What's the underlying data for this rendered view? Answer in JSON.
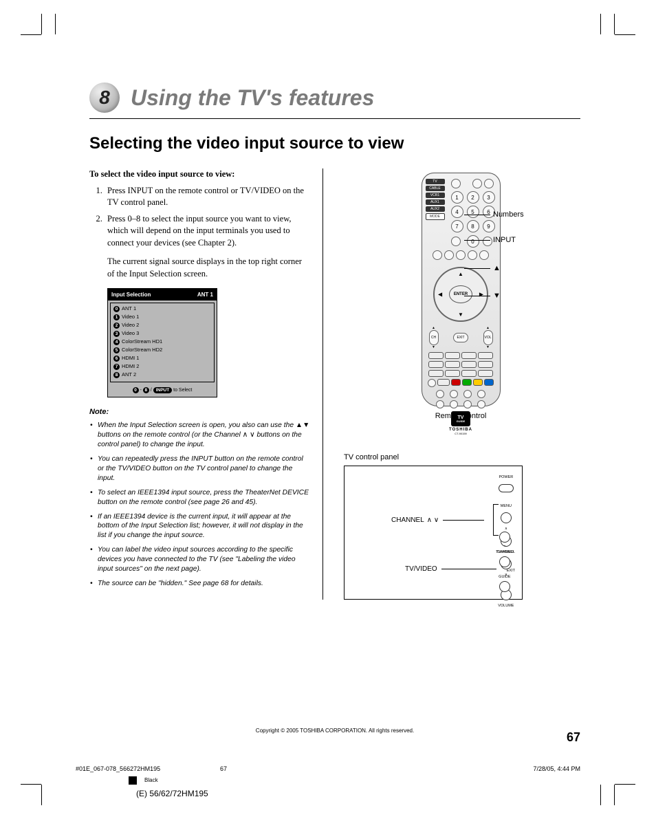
{
  "chapter": {
    "number": "8",
    "title": "Using the TV's features"
  },
  "section_title": "Selecting the video input source to view",
  "instr_head": "To select the video input source to view:",
  "steps": {
    "s1": "Press INPUT on the remote control or TV/VIDEO on the TV control panel.",
    "s2": "Press 0–8 to select the input source you want to view, which will depend on the input terminals you used to connect your devices (see Chapter 2)."
  },
  "followup": "The current signal source displays in the top right corner of the Input Selection screen.",
  "input_selection": {
    "title": "Input Selection",
    "current": "ANT 1",
    "items": [
      {
        "n": "0",
        "label": "ANT 1"
      },
      {
        "n": "1",
        "label": "Video 1"
      },
      {
        "n": "2",
        "label": "Video 2"
      },
      {
        "n": "3",
        "label": "Video 3"
      },
      {
        "n": "4",
        "label": "ColorStream HD1"
      },
      {
        "n": "5",
        "label": "ColorStream HD2"
      },
      {
        "n": "6",
        "label": "HDMI 1"
      },
      {
        "n": "7",
        "label": "HDMI 2"
      },
      {
        "n": "8",
        "label": "ANT 2"
      }
    ],
    "footer_btn": "INPUT",
    "footer_text": "to Select"
  },
  "note_head": "Note:",
  "notes": {
    "n1a": "When the Input Selection screen is open, you also can use the ",
    "n1b": " buttons on the remote control (or the Channel ",
    "n1c": " buttons on the control panel) to change the input.",
    "n2": "You can repeatedly press the INPUT button on the remote control or the TV/VIDEO button on the TV control panel to change the input.",
    "n3": "To select an IEEE1394 input source, press the TheaterNet DEVICE button on the remote control (see page 26 and 45).",
    "n4": "If an IEEE1394 device is the current input, it will appear at the bottom of the Input Selection list; however, it will not display in the list if you change the input source.",
    "n5": "You can label the video input sources according to the specific devices you have connected to the TV (see \"Labeling the video input sources\" on the next page).",
    "n6": "The source can be \"hidden.\" See page 68 for details."
  },
  "remote": {
    "caption": "Remote control",
    "callouts": {
      "numbers": "Numbers",
      "input": "INPUT",
      "up": "▲",
      "down": "▼"
    },
    "left_labels": [
      "TV",
      "CABLE",
      "VCR1",
      "AUX1",
      "AUX2",
      "MODE"
    ],
    "keypad": [
      "1",
      "2",
      "3",
      "4",
      "5",
      "6",
      "7",
      "8",
      "9"
    ],
    "keypad2": [
      "",
      "0",
      ""
    ],
    "enter": "ENTER",
    "brand": "TOSHIBA",
    "model": "CT-90159",
    "tvguide_top": "TV",
    "tvguide_bottom": "GUIDE"
  },
  "panel": {
    "caption": "TV control panel",
    "channel": "CHANNEL",
    "tvvideo": "TV/VIDEO",
    "power": "POWER",
    "menu": "MENU",
    "ch_label": "CHANNEL",
    "vol_label": "VOLUME",
    "tvv_label": "TV/VIDEO",
    "exit_label": "EXIT",
    "guide_label": "GUIDE"
  },
  "footer": {
    "copyright": "Copyright © 2005 TOSHIBA CORPORATION. All rights reserved.",
    "page": "67",
    "print_file": "#01E_067-078_566272HM195",
    "print_page": "67",
    "print_time": "7/28/05, 4:44 PM",
    "black": "Black",
    "model": "(E) 56/62/72HM195"
  }
}
